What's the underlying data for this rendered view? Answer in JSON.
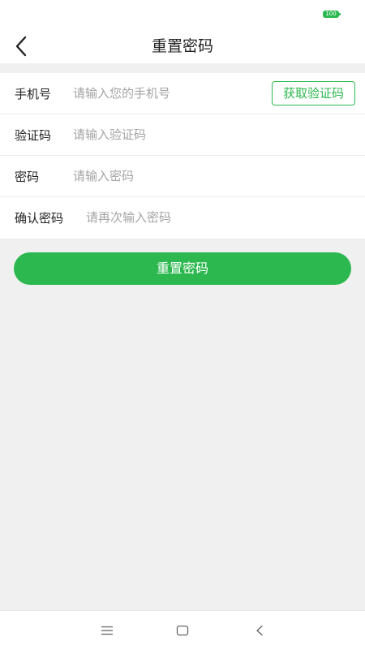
{
  "status_bar": {
    "battery_level": "100",
    "battery_color": "#2cb84f"
  },
  "header": {
    "title": "重置密码",
    "back_icon": "chevron-left-icon"
  },
  "form": {
    "phone": {
      "label": "手机号",
      "value": "",
      "placeholder": "请输入您的手机号",
      "get_code_label": "获取验证码"
    },
    "code": {
      "label": "验证码",
      "value": "",
      "placeholder": "请输入验证码"
    },
    "password": {
      "label": "密码",
      "value": "",
      "placeholder": "请输入密码"
    },
    "confirm": {
      "label": "确认密码",
      "value": "",
      "placeholder": "请再次输入密码"
    }
  },
  "submit": {
    "label": "重置密码"
  },
  "colors": {
    "accent": "#2cb84f",
    "page_background": "#f0f0f0"
  },
  "system_nav": {
    "icons": [
      "menu-icon",
      "home-icon",
      "back-icon"
    ]
  }
}
